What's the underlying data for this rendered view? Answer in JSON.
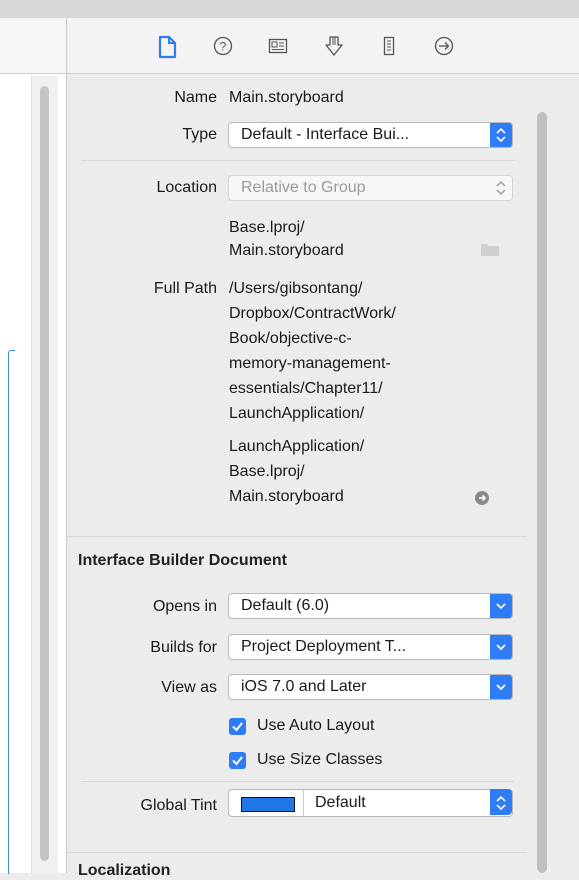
{
  "toolbar": {
    "icons": [
      "file-inspector-icon",
      "quick-help-icon",
      "identity-inspector-icon",
      "attributes-inspector-icon",
      "size-inspector-icon",
      "connections-inspector-icon"
    ]
  },
  "identity": {
    "name_label": "Name",
    "name_value": "Main.storyboard",
    "type_label": "Type",
    "type_value": "Default - Interface Bui...",
    "location_label": "Location",
    "location_value": "Relative to Group",
    "location_path_line1": "Base.lproj/",
    "location_path_line2": "Main.storyboard",
    "fullpath_label": "Full Path",
    "fullpath_lines": [
      "/Users/gibsontang/",
      "Dropbox/ContractWork/",
      "Book/objective-c-",
      "memory-management-",
      "essentials/Chapter11/",
      "LaunchApplication/",
      "LaunchApplication/",
      "Base.lproj/",
      "Main.storyboard"
    ]
  },
  "ib_document": {
    "section_title": "Interface Builder Document",
    "opens_in_label": "Opens in",
    "opens_in_value": "Default (6.0)",
    "builds_for_label": "Builds for",
    "builds_for_value": "Project Deployment T...",
    "view_as_label": "View as",
    "view_as_value": "iOS 7.0 and Later",
    "auto_layout_label": "Use Auto Layout",
    "auto_layout_checked": true,
    "size_classes_label": "Use Size Classes",
    "size_classes_checked": true,
    "global_tint_label": "Global Tint",
    "global_tint_value": "Default",
    "tint_color": "#1f77e6"
  },
  "localization": {
    "section_title": "Localization"
  },
  "colors": {
    "accent": "#2e7cf6"
  }
}
